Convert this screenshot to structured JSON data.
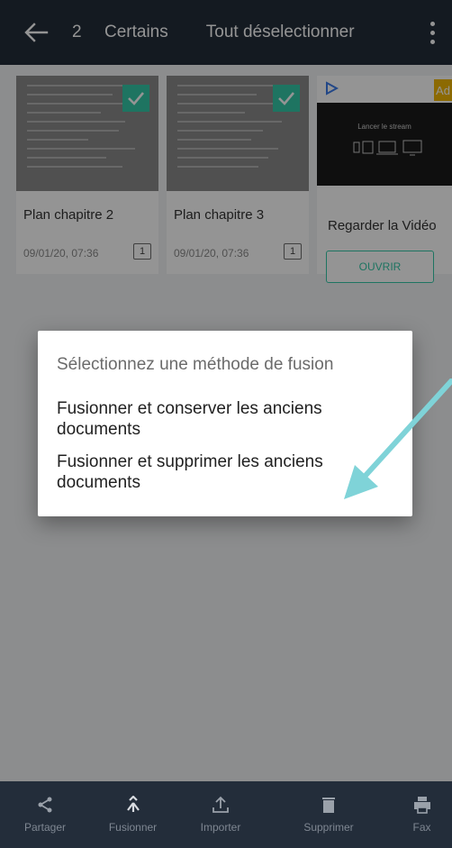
{
  "topbar": {
    "back_icon": "arrow-left-icon",
    "selected_count": "2",
    "certains_label": "Certains",
    "unselect_label": "Tout déselectionner",
    "more_icon": "more-vertical-icon"
  },
  "documents": [
    {
      "title": "Plan chapitre 2",
      "date": "09/01/20, 07:36",
      "pages": "1",
      "selected": true
    },
    {
      "title": "Plan chapitre 3",
      "date": "09/01/20, 07:36",
      "pages": "1",
      "selected": true
    }
  ],
  "ad": {
    "badge": "Ad",
    "stream_text": "Lancer le stream",
    "title": "Regarder la Vidéo",
    "button": "OUVRIR"
  },
  "dialog": {
    "title": "Sélectionnez une méthode de fusion",
    "option_keep": "Fusionner et conserver les anciens documents",
    "option_delete": "Fusionner et supprimer les anciens documents"
  },
  "bottombar": {
    "items": [
      {
        "label": "Partager",
        "icon": "share-icon"
      },
      {
        "label": "Fusionner",
        "icon": "merge-icon"
      },
      {
        "label": "Importer",
        "icon": "upload-icon"
      },
      {
        "label": "Supprimer",
        "icon": "trash-icon"
      },
      {
        "label": "Fax",
        "icon": "printer-icon"
      }
    ]
  },
  "colors": {
    "bar_bg": "#232d3a",
    "accent": "#35c9a8",
    "arrow": "#7fd3d8"
  }
}
